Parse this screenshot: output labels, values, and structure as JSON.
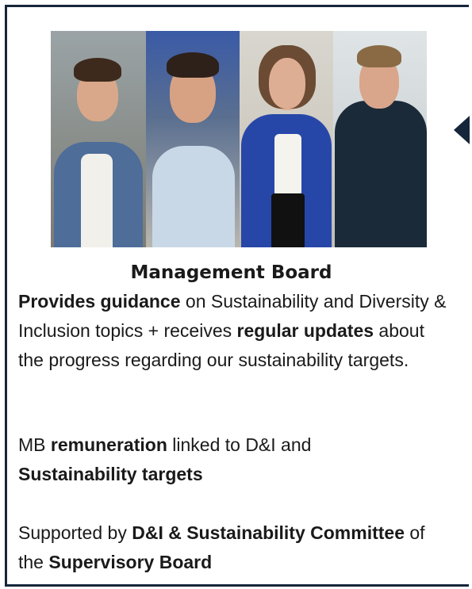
{
  "board": {
    "title": "Management Board",
    "p1": {
      "s1": "Provides guidance",
      "s2": " on Sustainability and Diversity & Inclusion topics + receives ",
      "s3": "regular updates",
      "s4": " about the progress regarding our sustainability targets."
    },
    "p2": {
      "s1": "MB ",
      "s2": "remuneration",
      "s3": " linked to D&I and ",
      "s4": "Sustainability targets"
    },
    "p3": {
      "s1": "Supported by ",
      "s2": "D&I & Sustainability Committee",
      "s3": " of the ",
      "s4": "Supervisory Board"
    }
  },
  "colors": {
    "border": "#16263a",
    "text": "#1a1a1a"
  },
  "icons": {
    "pointer": "left-pointer-triangle"
  }
}
